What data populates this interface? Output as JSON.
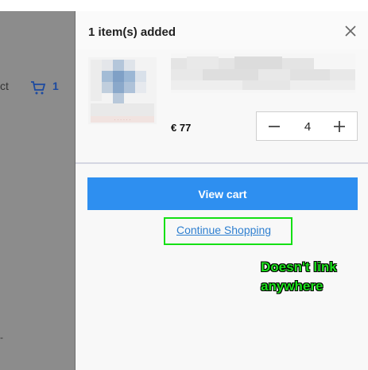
{
  "background_page": {
    "partial_text": "ct",
    "cart_count": "1",
    "bottom_text": "-"
  },
  "drawer": {
    "title": "1 item(s) added",
    "item": {
      "price": "€ 77",
      "quantity": "4"
    },
    "view_cart_label": "View cart",
    "continue_label": "Continue Shopping"
  },
  "annotation": {
    "text": "Doesn't link anywhere"
  },
  "colors": {
    "accent": "#2e8ff0",
    "link": "#2e7fd0",
    "annotation": "#1be01b",
    "cart_icon": "#1c4aa0",
    "backdrop": "#8c8c8c"
  }
}
